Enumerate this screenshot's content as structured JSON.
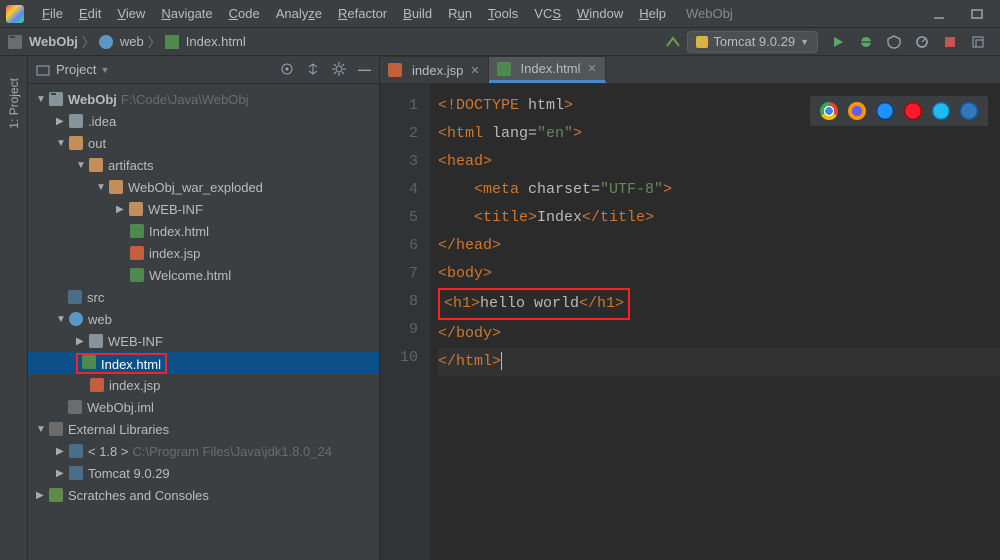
{
  "menu": [
    "File",
    "Edit",
    "View",
    "Navigate",
    "Code",
    "Analyze",
    "Refactor",
    "Build",
    "Run",
    "Tools",
    "VCS",
    "Window",
    "Help"
  ],
  "app_title": "WebObj",
  "breadcrumb": {
    "project": "WebObj",
    "folder": "web",
    "file": "Index.html"
  },
  "run_config": {
    "label": "Tomcat 9.0.29"
  },
  "sidebar": {
    "tab": "1: Project"
  },
  "project_panel": {
    "title": "Project"
  },
  "tree": {
    "root": {
      "name": "WebObj",
      "path": "F:\\Code\\Java\\WebObj"
    },
    "idea": ".idea",
    "out": "out",
    "artifacts": "artifacts",
    "war": "WebObj_war_exploded",
    "webinf1": "WEB-INF",
    "index_html1": "Index.html",
    "index_jsp1": "index.jsp",
    "welcome": "Welcome.html",
    "src": "src",
    "web": "web",
    "webinf2": "WEB-INF",
    "index_html2": "Index.html",
    "index_jsp2": "index.jsp",
    "iml": "WebObj.iml",
    "ext_lib": "External Libraries",
    "jdk": {
      "name": "< 1.8 >",
      "path": "C:\\Program Files\\Java\\jdk1.8.0_24"
    },
    "tomcat": "Tomcat 9.0.29",
    "scratches": "Scratches and Consoles"
  },
  "tabs": [
    {
      "name": "index.jsp",
      "active": false
    },
    {
      "name": "Index.html",
      "active": true
    }
  ],
  "line_count": 10,
  "code": {
    "l1": "<!DOCTYPE html>",
    "l2": "<html lang=\"en\">",
    "l3": "<head>",
    "l4": "    <meta charset=\"UTF-8\">",
    "l5": "    <title>Index</title>",
    "l6": "</head>",
    "l7": "<body>",
    "l8": "<h1>hello world</h1>",
    "l9": "</body>",
    "l10": "</html>"
  }
}
